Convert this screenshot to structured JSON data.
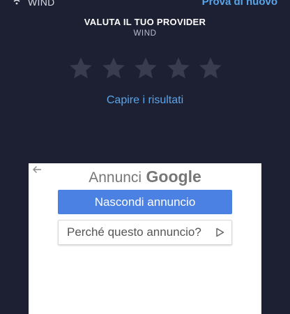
{
  "status_bar": {
    "carrier": "WIND",
    "action": "Prova di nuovo"
  },
  "rating": {
    "title": "VALUTA IL TUO PROVIDER",
    "provider": "WIND",
    "star_count": 5,
    "stars_selected": 0,
    "link": "Capire i risultati"
  },
  "ad": {
    "header_prefix": "Annunci",
    "header_brand": "Google",
    "hide_button": "Nascondi annuncio",
    "why_button": "Perché questo annuncio?"
  },
  "colors": {
    "background": "#1d2033",
    "accent_link": "#5aa5e8",
    "star_empty": "#383c4f",
    "ad_button": "#4a81e2"
  }
}
